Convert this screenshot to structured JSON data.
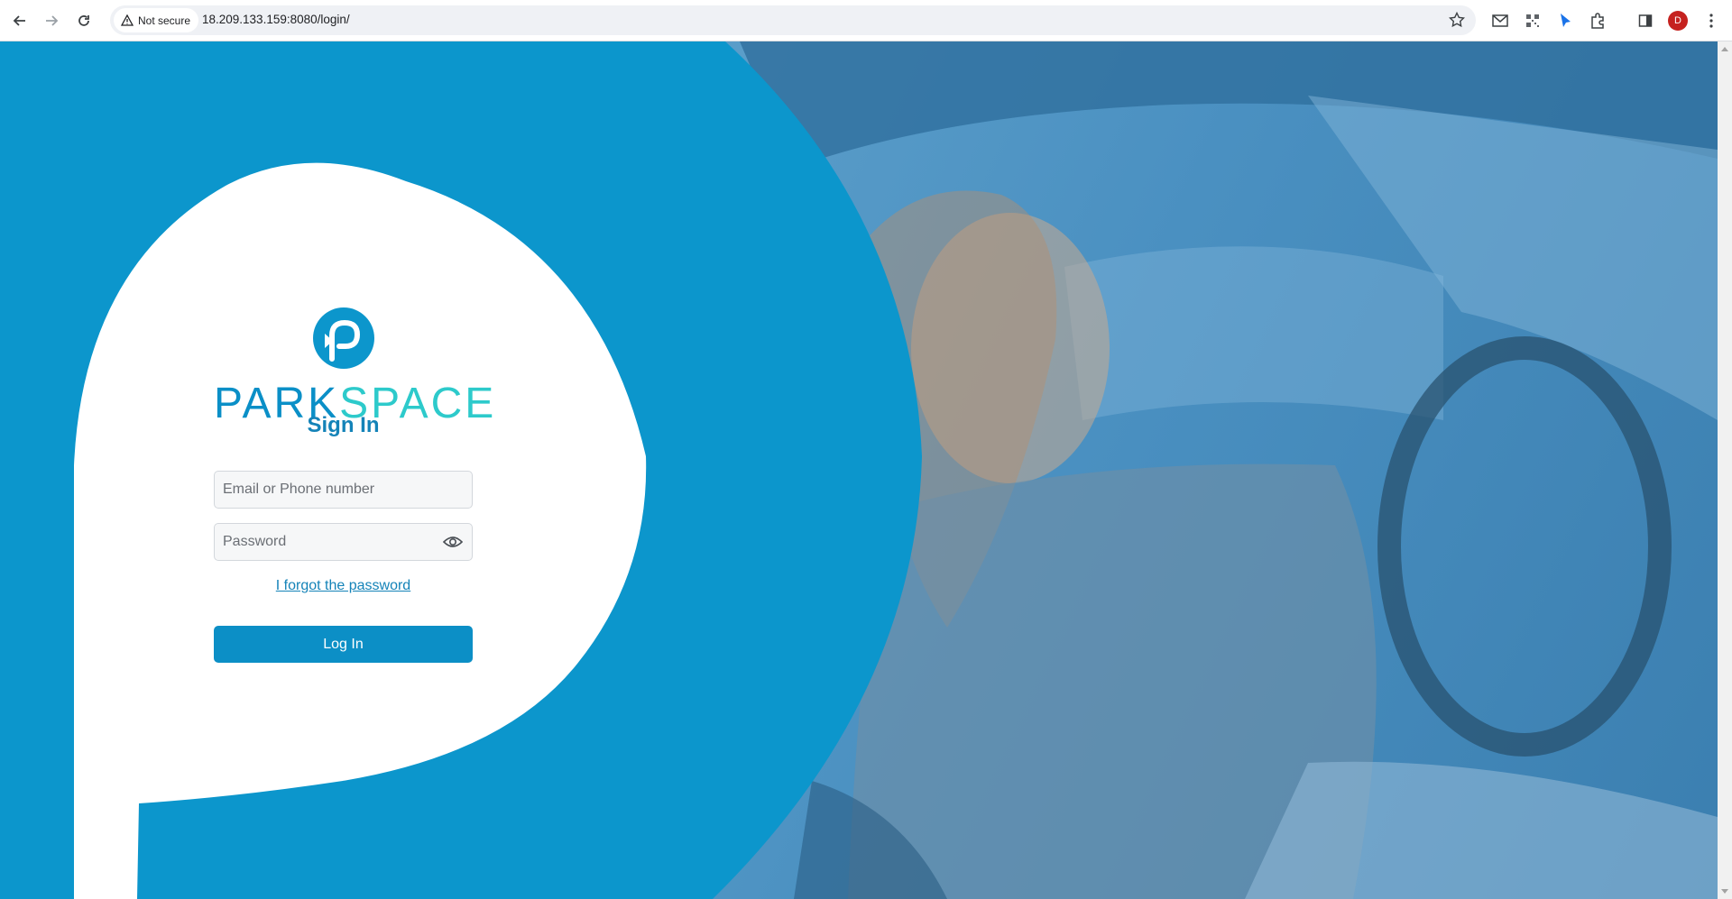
{
  "browser": {
    "security_label": "Not secure",
    "url": "18.209.133.159:8080/login/",
    "profile_initial": "D"
  },
  "colors": {
    "brand_blue": "#0c96cc",
    "brand_teal": "#2dcacb",
    "accent_dark": "#1483b8"
  },
  "login": {
    "brand_part1": "PARK",
    "brand_part2": "SPACE",
    "title": "Sign In",
    "email_placeholder": "Email or Phone number",
    "password_placeholder": "Password",
    "forgot_link": "I forgot the password",
    "login_button": "Log In"
  },
  "icons": [
    "back-icon",
    "forward-icon",
    "reload-icon",
    "warning-icon",
    "star-icon",
    "gmail-icon",
    "qr-icon",
    "cursor-icon",
    "extensions-icon",
    "sidepanel-icon",
    "menu-icon",
    "eye-icon",
    "parkspace-logo-icon"
  ]
}
